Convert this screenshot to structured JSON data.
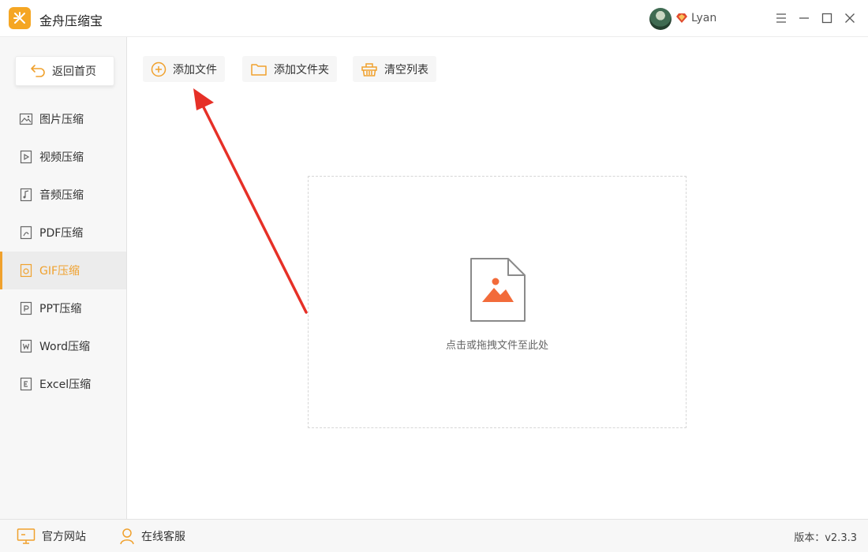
{
  "app": {
    "title": "金舟压缩宝",
    "user_name": "Lyan",
    "accent": "#f0a12d"
  },
  "sidebar": {
    "back_label": "返回首页",
    "active_index": 4,
    "items": [
      {
        "label": "图片压缩",
        "icon": "image-icon"
      },
      {
        "label": "视频压缩",
        "icon": "video-icon"
      },
      {
        "label": "音频压缩",
        "icon": "audio-icon"
      },
      {
        "label": "PDF压缩",
        "icon": "pdf-icon"
      },
      {
        "label": "GIF压缩",
        "icon": "gif-icon"
      },
      {
        "label": "PPT压缩",
        "icon": "ppt-icon"
      },
      {
        "label": "Word压缩",
        "icon": "word-icon"
      },
      {
        "label": "Excel压缩",
        "icon": "excel-icon"
      }
    ]
  },
  "toolbar": {
    "add_file": "添加文件",
    "add_folder": "添加文件夹",
    "clear_list": "清空列表"
  },
  "dropzone": {
    "hint": "点击或拖拽文件至此处"
  },
  "statusbar": {
    "website": "官方网站",
    "support": "在线客服",
    "version": "版本：v2.3.3"
  }
}
